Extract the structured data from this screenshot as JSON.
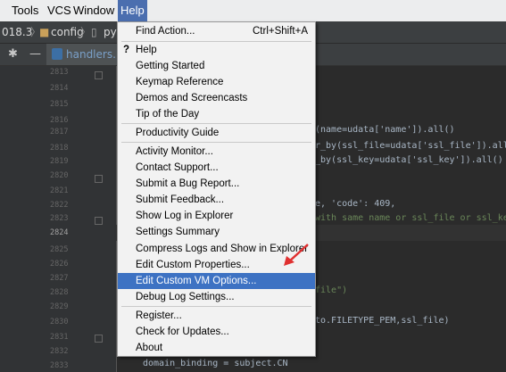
{
  "menubar": {
    "items": [
      "Tools",
      "VCS",
      "Window",
      "Help"
    ],
    "active": "Help"
  },
  "navbar": {
    "version": "018.3",
    "folder": "config",
    "file_fragment": "py"
  },
  "tab": {
    "label": "handlers.py"
  },
  "line_numbers": [
    "2813",
    "2814",
    "2815",
    "2816",
    "2817",
    "2818",
    "2819",
    "2820",
    "2821",
    "2822",
    "2823",
    "2824",
    "2825",
    "2826",
    "2827",
    "2828",
    "2829",
    "2830",
    "2831",
    "2832",
    "2833"
  ],
  "current_line": "2824",
  "code": {
    "l2817": "(name=udata['name']).all()",
    "l2818": "r_by(ssl_file=udata['ssl_file']).all()",
    "l2819": "_by(ssl_key=udata['ssl_key']).all()",
    "l2822": "e, 'code': 409,",
    "l2823": "with same name or ssl_file or ssl_key",
    "l2828": "file\")",
    "l2830": "to.FILETYPE_PEM,ssl_file)",
    "l2833": "domain_binding = subject.CN"
  },
  "help_menu": {
    "items": [
      {
        "label": "Find Action...",
        "shortcut": "Ctrl+Shift+A"
      },
      {
        "label": "Help",
        "icon": "question-icon"
      },
      {
        "label": "Getting Started"
      },
      {
        "label": "Keymap Reference"
      },
      {
        "label": "Demos and Screencasts"
      },
      {
        "label": "Tip of the Day"
      },
      {
        "label": "Productivity Guide"
      },
      {
        "label": "Activity Monitor..."
      },
      {
        "label": "Contact Support..."
      },
      {
        "label": "Submit a Bug Report..."
      },
      {
        "label": "Submit Feedback..."
      },
      {
        "label": "Show Log in Explorer"
      },
      {
        "label": "Settings Summary"
      },
      {
        "label": "Compress Logs and Show in Explorer"
      },
      {
        "label": "Edit Custom Properties..."
      },
      {
        "label": "Edit Custom VM Options..."
      },
      {
        "label": "Debug Log Settings..."
      },
      {
        "label": "Register..."
      },
      {
        "label": "Check for Updates..."
      },
      {
        "label": "About"
      }
    ],
    "highlighted": "Edit Custom VM Options..."
  },
  "colors": {
    "menu_highlight": "#3d72c3",
    "arrow": "#e03030"
  }
}
